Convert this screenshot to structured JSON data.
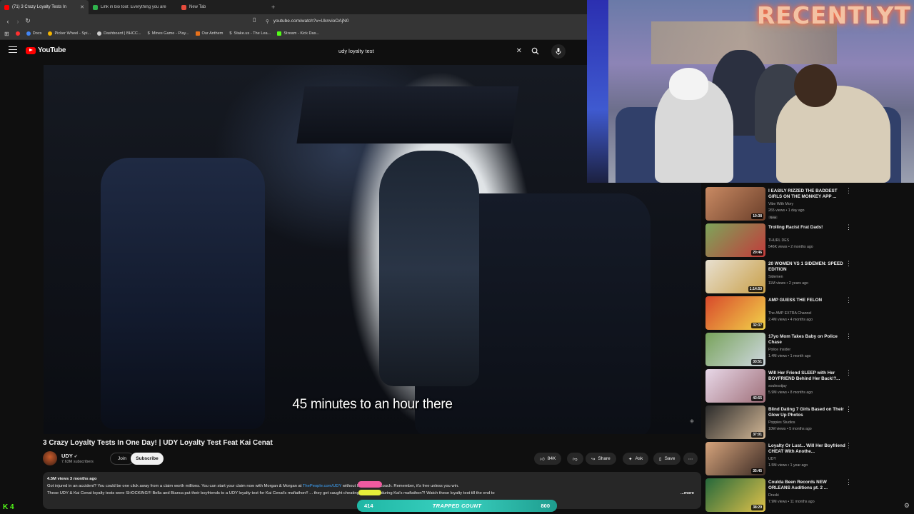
{
  "browser": {
    "tabs": [
      {
        "label": "(71) 3 Crazy Loyalty Tests In",
        "color": "#ff0000",
        "active": true
      },
      {
        "label": "Link in bio tool: Everything you are",
        "color": "#2fb24c",
        "active": false
      },
      {
        "label": "New Tab",
        "color": "#e74c3c",
        "active": false
      }
    ],
    "new_tab": "+",
    "url": "youtube.com/watch?v=UknvioOAjN0",
    "bookmarks": [
      {
        "label": "",
        "color": "#ff3030"
      },
      {
        "label": "Docs",
        "color": "#4285f4"
      },
      {
        "label": "Picker Wheel - Spi...",
        "color": "#f4b400"
      },
      {
        "label": "Dashboard | BHCC...",
        "color": "#cccccc"
      },
      {
        "label": "Mines Game - Play...",
        "color": "#cccccc"
      },
      {
        "label": "Our Anthem",
        "color": "#e8711a"
      },
      {
        "label": "Stake.us - The Lea...",
        "color": "#cccccc"
      },
      {
        "label": "Stream - Kick Das...",
        "color": "#53fc18"
      }
    ]
  },
  "youtube": {
    "logo": "YouTube",
    "search_query": "udy loyalty test"
  },
  "video": {
    "subtitle": "45 minutes to an hour there",
    "title": "3 Crazy Loyalty Tests In One Day! | UDY Loyalty Test Feat Kai Cenat",
    "channel": "UDY",
    "subscribers": "7.63M subscribers",
    "join_label": "Join",
    "subscribe_label": "Subscribe",
    "likes": "84K",
    "share_label": "Share",
    "ask_label": "Ask",
    "save_label": "Save",
    "views_age": "4.5M views  3 months ago",
    "desc_line1_a": "Got injured in an accident? You could be one click away from a claim worth millions. You can start your claim now with Morgan & Morgan at ",
    "desc_link": "ThePeople.com/UDY",
    "desc_line1_b": " without leaving your couch. Remember, it's free unless you win.",
    "desc_line2": "These UDY & Kai Cenat loyalty tests were SHOCKING!!! Bella and Bianca put their boyfriends to a UDY loyalty test for Kai Cenat's mafiathon!! ... they get caught cheating on camera during Kai's mafiathon?! Watch these loyalty test till the end to",
    "more_label": "...more"
  },
  "stream_overlay": {
    "webcam_sign": "RECENTLYT",
    "left_count": "414",
    "label": "TRAPPED COUNT",
    "right_count": "800",
    "kick_logo": "K 4"
  },
  "recommendations": [
    {
      "title": "I EASILY RIZZED THE BADDEST GIRLS ON THE MONKEY APP ...",
      "channel": "Vibe With Mory",
      "meta": "265 views • 1 day ago",
      "badge": "New",
      "duration": "10:38",
      "thumb": [
        "#c98a63",
        "#6b3f2a"
      ]
    },
    {
      "title": "Trolling Racist Frat Dads!",
      "channel": "THURL DES",
      "meta": "546K views • 2 months ago",
      "badge": "",
      "duration": "20:46",
      "thumb": [
        "#7da55a",
        "#c23b3b"
      ]
    },
    {
      "title": "20 WOMEN VS 1 SIDEMEN: SPEED EDITION",
      "channel": "Sidemen",
      "meta": "11M views • 2 years ago",
      "badge": "",
      "duration": "1:14:53",
      "thumb": [
        "#e8e0d0",
        "#c9a04a"
      ]
    },
    {
      "title": "AMP GUESS THE FELON",
      "channel": "The AMP EXTRA Channel",
      "meta": "2.4M views • 4 months ago",
      "badge": "",
      "duration": "32:37",
      "thumb": [
        "#d8492b",
        "#f2d34a"
      ]
    },
    {
      "title": "17yo Mom Takes Baby on Police Chase",
      "channel": "Police Insider",
      "meta": "1.4M views • 1 month ago",
      "badge": "",
      "duration": "33:51",
      "thumb": [
        "#78a35b",
        "#cfd8e0"
      ]
    },
    {
      "title": "Will Her Friend SLEEP with Her BOYFRIEND Behind Her Back!?...",
      "channel": "soulesstjay",
      "meta": "5.9M views • 8 months ago",
      "badge": "",
      "duration": "43:55",
      "thumb": [
        "#e8d8e8",
        "#a0707a"
      ]
    },
    {
      "title": "Blind Dating 7 Girls Based on Their Glow Up Photos",
      "channel": "Poppies Studios",
      "meta": "10M views • 5 months ago",
      "badge": "",
      "duration": "37:01",
      "thumb": [
        "#2b2b2b",
        "#d4b896"
      ]
    },
    {
      "title": "Loyalty Or Lust... Will Her Boyfriend CHEAT With Anothe...",
      "channel": "UDY",
      "meta": "1.5M views • 1 year ago",
      "badge": "",
      "duration": "35:45",
      "thumb": [
        "#d6a47c",
        "#3b2a24"
      ]
    },
    {
      "title": "Coulda Been Records NEW ORLEANS Auditions pt. 2 ...",
      "channel": "Druski",
      "meta": "7.9M views • 11 months ago",
      "badge": "",
      "duration": "38:29",
      "thumb": [
        "#25683b",
        "#e0c24a"
      ]
    }
  ]
}
